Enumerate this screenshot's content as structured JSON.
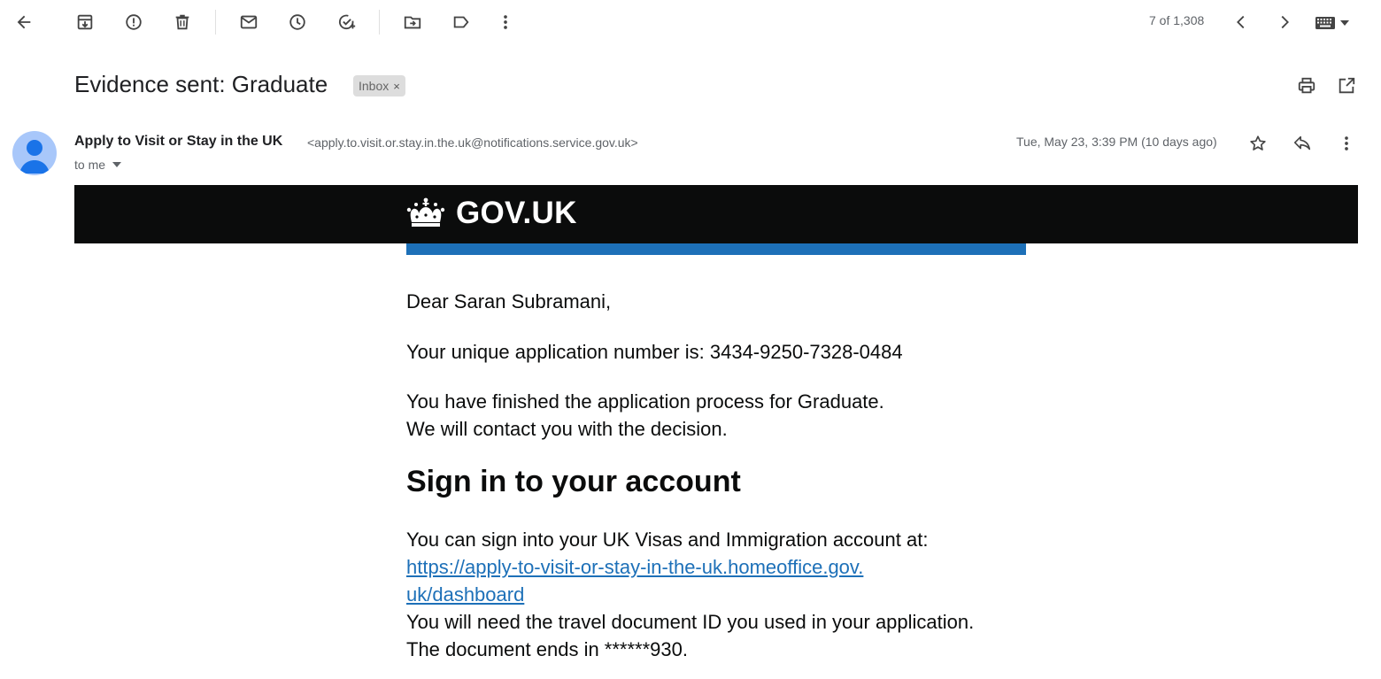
{
  "toolbar": {
    "page_counter": "7 of 1,308"
  },
  "email": {
    "subject": "Evidence sent: Graduate",
    "label_chip": "Inbox",
    "label_chip_close": "×",
    "sender_name": "Apply to Visit or Stay in the UK",
    "sender_email": "<apply.to.visit.or.stay.in.the.uk@notifications.service.gov.uk>",
    "recipient": "to me",
    "date": "Tue, May 23, 3:39 PM (10 days ago)"
  },
  "body": {
    "brand": "GOV.UK",
    "greeting": "Dear Saran Subramani,",
    "application_number": "Your unique application number is: 3434-9250-7328-0484",
    "finished_line1": "You have finished the application process for Graduate.",
    "finished_line2": "We will contact you with the decision.",
    "heading": "Sign in to your account",
    "signin_text": "You can sign into your UK Visas and Immigration account at:",
    "link_line1": "https://apply-to-visit-or-stay-in-the-uk.homeoffice.gov.",
    "link_line2": "uk/dashboard",
    "travel_doc_line": "You will need the travel document ID you used in your application.",
    "document_line": "The document ends in ******930."
  },
  "colors": {
    "gov_black": "#0b0c0c",
    "gov_blue": "#1d70b8",
    "avatar_bg": "#a8c7fa",
    "avatar_fg": "#1a73e8"
  },
  "icons": [
    "back-arrow-icon",
    "archive-icon",
    "report-spam-icon",
    "delete-icon",
    "mark-unread-icon",
    "snooze-icon",
    "add-to-tasks-icon",
    "move-to-icon",
    "label-icon",
    "more-vert-icon",
    "prev-chevron-icon",
    "next-chevron-icon",
    "keyboard-icon",
    "print-icon",
    "open-new-window-icon",
    "star-icon",
    "reply-icon",
    "crown-icon"
  ]
}
